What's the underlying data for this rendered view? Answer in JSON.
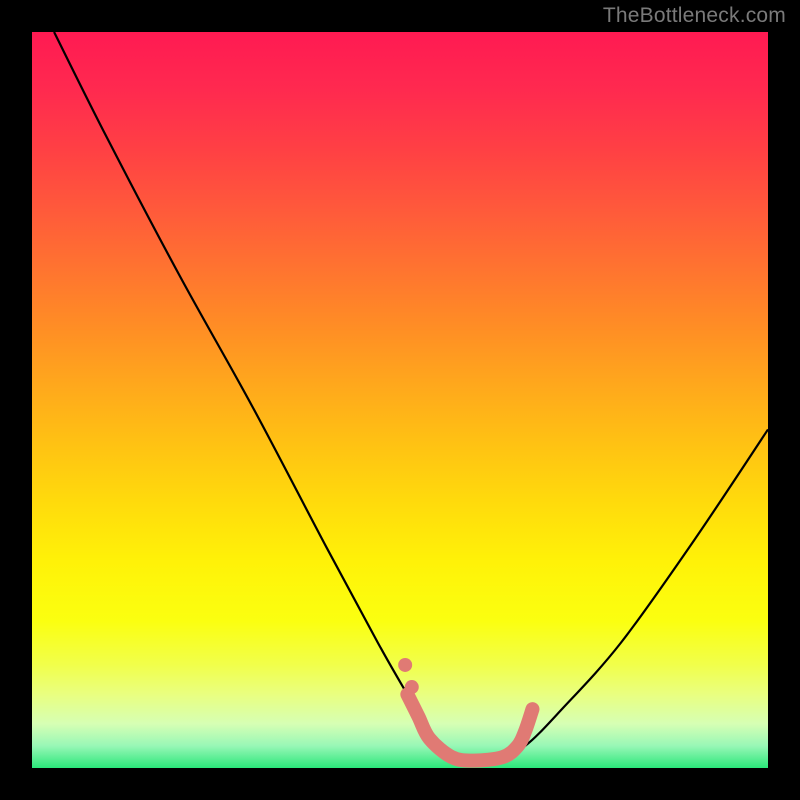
{
  "watermark": "TheBottleneck.com",
  "chart_data": {
    "type": "line",
    "title": "",
    "xlabel": "",
    "ylabel": "",
    "xlim": [
      0,
      100
    ],
    "ylim": [
      0,
      100
    ],
    "series": [
      {
        "name": "bottleneck-curve",
        "x": [
          3,
          10,
          20,
          30,
          40,
          47,
          51,
          54,
          57,
          60,
          63,
          67,
          72,
          80,
          90,
          100
        ],
        "y": [
          100,
          86,
          67,
          49,
          30,
          17,
          10,
          5,
          2,
          1,
          1,
          3,
          8,
          17,
          31,
          46
        ]
      },
      {
        "name": "optimal-highlight",
        "x": [
          51,
          52.5,
          54,
          57,
          60,
          64,
          66,
          67,
          68
        ],
        "y": [
          10,
          7,
          4,
          1.5,
          1,
          1.5,
          3,
          5,
          8
        ]
      }
    ],
    "colors": {
      "curve": "#000000",
      "highlight": "#e07a74"
    }
  }
}
